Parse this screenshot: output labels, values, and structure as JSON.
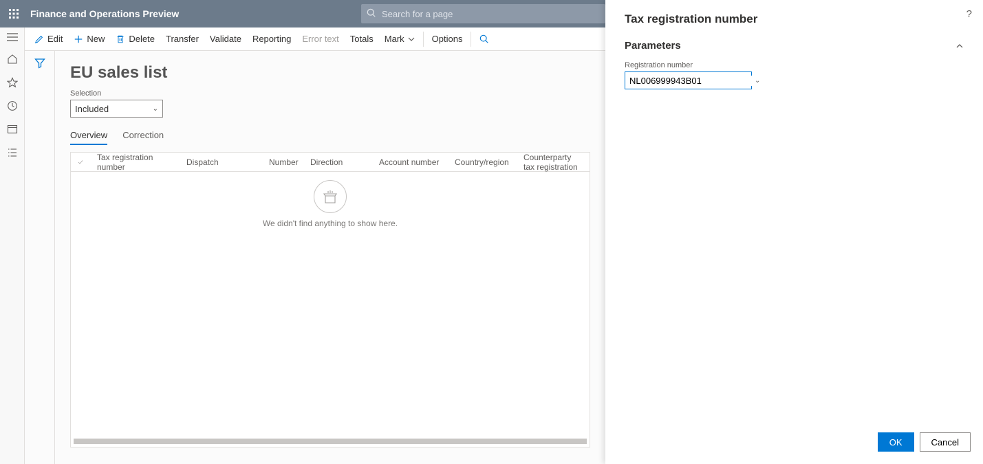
{
  "app": {
    "title": "Finance and Operations Preview"
  },
  "search": {
    "placeholder": "Search for a page"
  },
  "commands": {
    "edit": "Edit",
    "new": "New",
    "delete": "Delete",
    "transfer": "Transfer",
    "validate": "Validate",
    "reporting": "Reporting",
    "error_text": "Error text",
    "totals": "Totals",
    "mark": "Mark",
    "options": "Options"
  },
  "page": {
    "title": "EU sales list",
    "selection_label": "Selection",
    "selection_value": "Included"
  },
  "tabs": {
    "overview": "Overview",
    "correction": "Correction"
  },
  "grid": {
    "columns": {
      "tax_reg_no": "Tax registration number",
      "dispatch": "Dispatch",
      "number": "Number",
      "direction": "Direction",
      "account_number": "Account number",
      "country_region": "Country/region",
      "counterparty": "Counterparty tax registration"
    },
    "empty_text": "We didn't find anything to show here."
  },
  "flyout": {
    "title": "Tax registration number",
    "section": "Parameters",
    "param_label": "Registration number",
    "param_value": "NL006999943B01",
    "ok": "OK",
    "cancel": "Cancel"
  }
}
